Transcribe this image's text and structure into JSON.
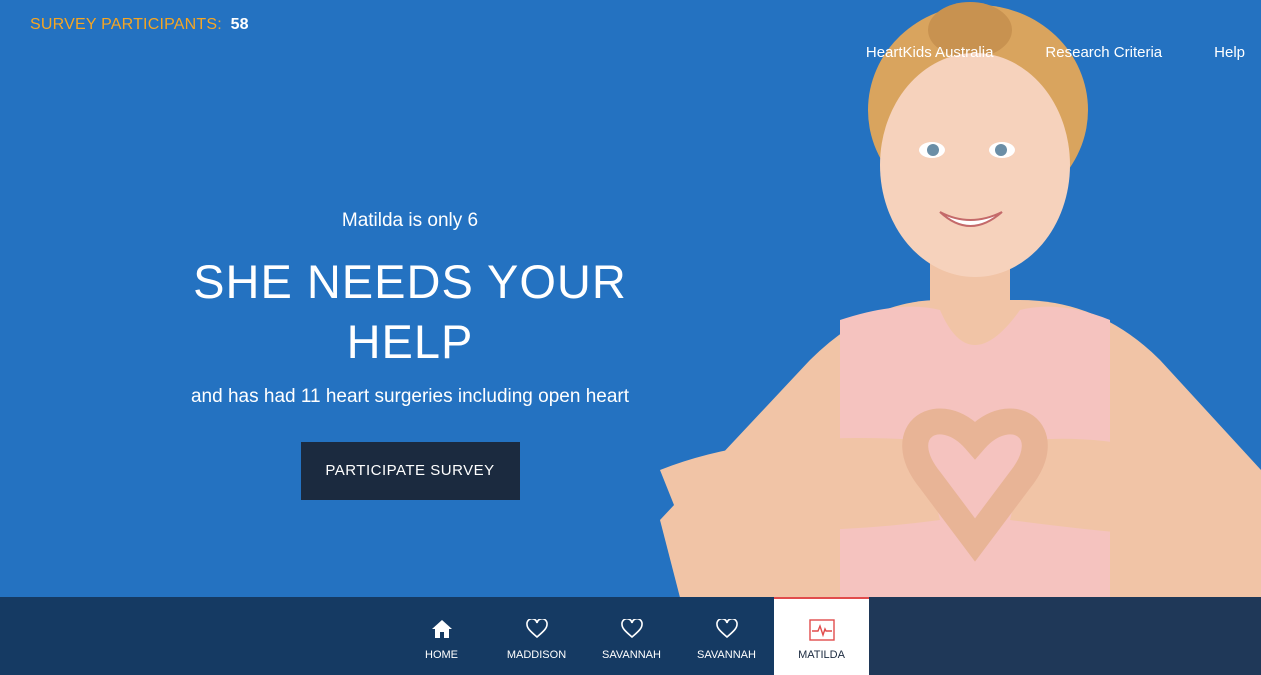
{
  "counter": {
    "label": "SURVEY PARTICIPANTS:",
    "value": "58"
  },
  "nav": {
    "links": [
      "HeartKids Australia",
      "Research Criteria",
      "Help"
    ]
  },
  "hero": {
    "kicker": "Matilda is only 6",
    "headline_line1": "SHE NEEDS YOUR",
    "headline_line2": "HELP",
    "subline": "and has had 11 heart surgeries including open heart",
    "cta_label": "PARTICIPATE SURVEY"
  },
  "tabs": [
    {
      "label": "HOME",
      "icon": "home-icon"
    },
    {
      "label": "MADDISON",
      "icon": "heart-outline-icon"
    },
    {
      "label": "SAVANNAH",
      "icon": "heart-outline-icon"
    },
    {
      "label": "SAVANNAH",
      "icon": "heart-outline-icon"
    },
    {
      "label": "MATILDA",
      "icon": "heartbeat-monitor-icon",
      "active": true
    }
  ],
  "colors": {
    "background": "#2472c1",
    "accent": "#f6a623",
    "cta": "#1b2a3f",
    "bar": "#153a63",
    "active_indicator": "#e14c4c"
  }
}
